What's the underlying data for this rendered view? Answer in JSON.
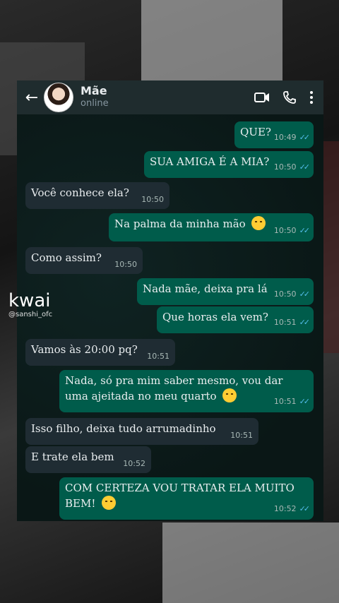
{
  "header": {
    "contact_name": "Mãe",
    "status": "online",
    "back_icon": "arrow-left-icon",
    "icons": [
      "video-icon",
      "phone-icon",
      "more-vert-icon"
    ]
  },
  "messages": [
    {
      "dir": "out",
      "text": "QUE?",
      "time": "10:49"
    },
    {
      "dir": "out",
      "text": "SUA AMIGA É A MIA?",
      "time": "10:50"
    },
    {
      "dir": "in",
      "text": "Você conhece ela?",
      "time": "10:50"
    },
    {
      "dir": "out",
      "text": "Na palma da minha mão",
      "time": "10:50",
      "emoji": "smirk-face-icon"
    },
    {
      "dir": "in",
      "text": "Como assim?",
      "time": "10:50"
    },
    {
      "dir": "out",
      "text": "Nada mãe, deixa pra lá",
      "time": "10:50"
    },
    {
      "dir": "out",
      "text": "Que horas ela vem?",
      "time": "10:51"
    },
    {
      "dir": "in",
      "text": "Vamos às 20:00 pq?",
      "time": "10:51"
    },
    {
      "dir": "out",
      "text": "Nada, só pra mim saber mesmo, vou dar uma ajeitada no meu quarto",
      "time": "10:51",
      "emoji": "winking-tongue-face-icon"
    },
    {
      "dir": "in",
      "text": "Isso filho, deixa tudo arrumadinho",
      "time": "10:51"
    },
    {
      "dir": "in",
      "text": "E trate ela bem",
      "time": "10:52"
    },
    {
      "dir": "out",
      "text": "COM CERTEZA VOU TRATAR ELA MUITO BEM!",
      "time": "10:52",
      "emoji": "flushed-face-icon"
    }
  ],
  "read_receipt": "✓✓",
  "watermark": {
    "logo": "kwai",
    "username": "@sanshi_ofc"
  },
  "colors": {
    "incoming_bubble": "#1f2c33",
    "outgoing_bubble": "#005c4b",
    "read_check": "#53bdeb"
  }
}
